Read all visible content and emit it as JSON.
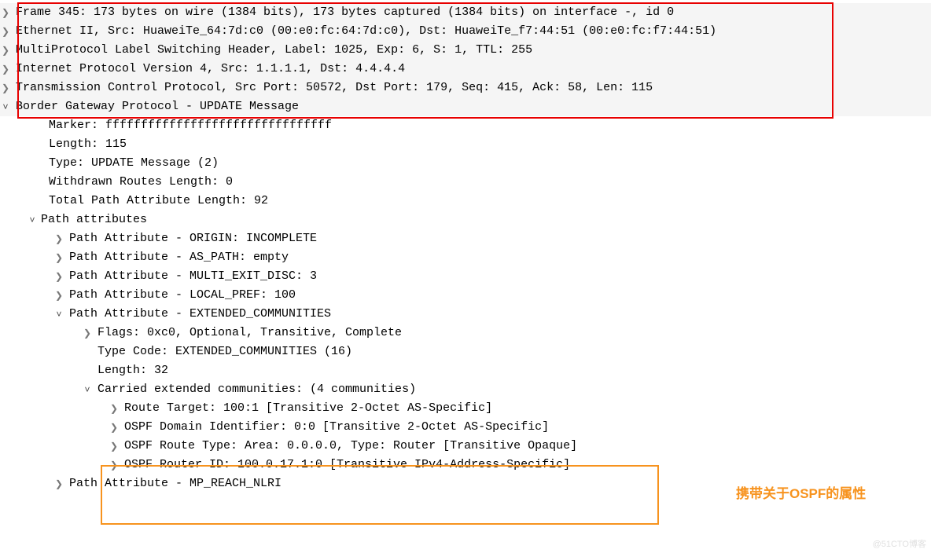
{
  "header": {
    "frame": "Frame 345: 173 bytes on wire (1384 bits), 173 bytes captured (1384 bits) on interface -, id 0",
    "eth": "Ethernet II, Src: HuaweiTe_64:7d:c0 (00:e0:fc:64:7d:c0), Dst: HuaweiTe_f7:44:51 (00:e0:fc:f7:44:51)",
    "mpls": "MultiProtocol Label Switching Header, Label: 1025, Exp: 6, S: 1, TTL: 255",
    "ip": "Internet Protocol Version 4, Src: 1.1.1.1, Dst: 4.4.4.4",
    "tcp": "Transmission Control Protocol, Src Port: 50572, Dst Port: 179, Seq: 415, Ack: 58, Len: 115",
    "bgp": "Border Gateway Protocol - UPDATE Message"
  },
  "bgp": {
    "marker": "Marker: ffffffffffffffffffffffffffffffff",
    "length": "Length: 115",
    "type": "Type: UPDATE Message (2)",
    "withdrawn": "Withdrawn Routes Length: 0",
    "tpal": "Total Path Attribute Length: 92",
    "pa_header": "Path attributes",
    "attrs": {
      "origin": "Path Attribute - ORIGIN: INCOMPLETE",
      "aspath": "Path Attribute - AS_PATH: empty",
      "med": "Path Attribute - MULTI_EXIT_DISC: 3",
      "localpref": "Path Attribute - LOCAL_PREF: 100",
      "extcomm": "Path Attribute - EXTENDED_COMMUNITIES",
      "mpreach": "Path Attribute - MP_REACH_NLRI"
    },
    "extcomm": {
      "flags": "Flags: 0xc0, Optional, Transitive, Complete",
      "typecode": "Type Code: EXTENDED_COMMUNITIES (16)",
      "length": "Length: 32",
      "carried": "Carried extended communities: (4 communities)",
      "rt": "Route Target: 100:1 [Transitive 2-Octet AS-Specific]",
      "ospfdi": "OSPF Domain Identifier: 0:0 [Transitive 2-Octet AS-Specific]",
      "ospfrt": "OSPF Route Type: Area: 0.0.0.0, Type: Router [Transitive Opaque]",
      "ospfrid": "OSPF Router ID: 100.0.17.1:0 [Transitive IPv4-Address-Specific]"
    }
  },
  "annotation": "携带关于OSPF的属性",
  "watermark": "@51CTO博客"
}
